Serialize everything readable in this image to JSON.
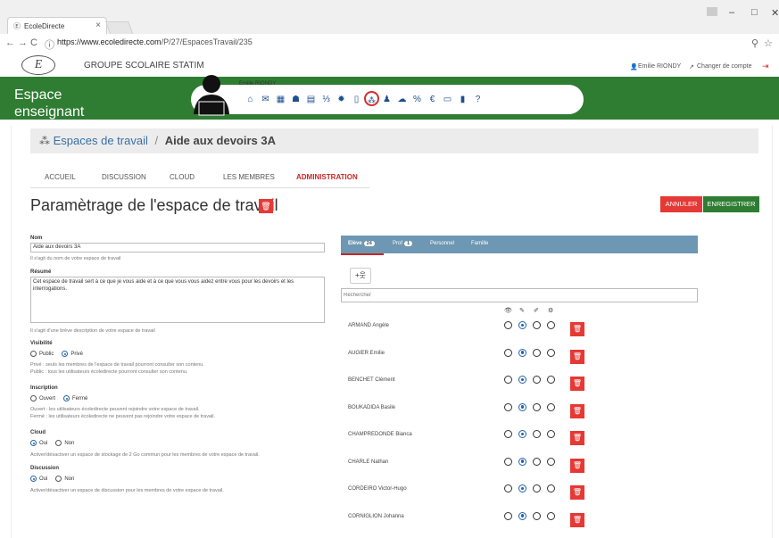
{
  "browser": {
    "tab_title": "EcoleDirecte",
    "tab_close": "×",
    "url_domain": "https://www.ecoledirecte.com",
    "url_path": "/P/27/EspacesTravail/235",
    "minimize": "–",
    "maximize": "□",
    "close": "✕",
    "back": "←",
    "forward": "→",
    "reload": "C",
    "info": "ⓘ",
    "ext_icon": "⚲",
    "star_icon": "☆"
  },
  "school": {
    "logo": "E",
    "name": "GROUPE SCOLAIRE STATIM",
    "user": "Emilie RIONDY",
    "change_account": "Changer de compte",
    "logout": "⇥"
  },
  "header": {
    "space_line1": "Espace",
    "space_line2": "enseignant",
    "profile_name": "Emilie RIONDY",
    "nav_icons": [
      "home-icon",
      "mail-icon",
      "calendar-icon",
      "students-icon",
      "clipboard-icon",
      "grades-icon",
      "settings-icon",
      "notebook-icon",
      "workspaces-icon",
      "meeting-icon",
      "cloud-icon",
      "link-icon",
      "euro-icon",
      "card-icon",
      "book-icon",
      "help-icon"
    ],
    "nav_glyphs": [
      "⌂",
      "✉",
      "▦",
      "☗",
      "▤",
      "⅓",
      "✹",
      "▯",
      "⁂",
      "♟",
      "☁",
      "%",
      "€",
      "▭",
      "▮",
      "?"
    ],
    "active_index": 8
  },
  "breadcrumb": {
    "root": "Espaces de travail",
    "separator": "/",
    "current": "Aide aux devoirs 3A"
  },
  "tabs": [
    "ACCUEIL",
    "DISCUSSION",
    "CLOUD",
    "LES MEMBRES",
    "ADMINISTRATION"
  ],
  "page": {
    "title": "Paramètrage de l'espace de travail",
    "cancel": "ANNULER",
    "save": "ENREGISTRER"
  },
  "form": {
    "name_label": "Nom",
    "name_value": "Aide aux devoirs 3A",
    "name_help": "Il s'agit du nom de votre espace de travail",
    "summary_label": "Résumé",
    "summary_value": "Cet espace de travail sert à ce que je vous aide et à ce que vous vous aidez entre vous pour les devoirs et les interrogations.",
    "summary_help": "Il s'agit d'une brève description de votre espace de travail",
    "visibility_label": "Visibilité",
    "visibility_public": "Public",
    "visibility_private": "Privé",
    "visibility_help1": "Privé : seuls les membres de l'espace de travail pourront consulter son contenu.",
    "visibility_help2": "Public : tous les utilisateurs écoledirecte pourront consulter son contenu.",
    "inscription_label": "Inscription",
    "inscription_open": "Ouvert",
    "inscription_closed": "Fermé",
    "inscription_help1": "Ouvert : les utilisateurs écoledirecte peuvent rejoindre votre espace de travail.",
    "inscription_help2": "Fermé : les utilisateurs écoledirecte ne peuvent pas rejoindre votre espace de travail.",
    "cloud_label": "Cloud",
    "cloud_yes": "Oui",
    "cloud_no": "Non",
    "cloud_help": "Activer/désactiver un espace de stockage de 2 Go commun pour les membres de votre espace de travail.",
    "discussion_label": "Discussion",
    "discussion_yes": "Oui",
    "discussion_no": "Non",
    "discussion_help": "Activer/désactiver un espace de discussion pour les membres de votre espace de travail."
  },
  "members": {
    "tabs": [
      {
        "label": "Elève",
        "count": "24"
      },
      {
        "label": "Prof",
        "count": "1"
      },
      {
        "label": "Personnel",
        "count": ""
      },
      {
        "label": "Famille",
        "count": ""
      }
    ],
    "add_button": "+웃",
    "search_placeholder": "Rechercher",
    "perm_icons": [
      "eye-icon",
      "pencil-icon",
      "eraser-icon",
      "admin-icon"
    ],
    "perm_glyphs": [
      "👁",
      "✎",
      "✐",
      "⚙"
    ],
    "students": [
      {
        "name": "ARMAND Angèle",
        "selected": 1
      },
      {
        "name": "AUGIER Emilie",
        "selected": 1
      },
      {
        "name": "BENCHET Clément",
        "selected": 1
      },
      {
        "name": "BOUKADIDA Basile",
        "selected": 1
      },
      {
        "name": "CHAMPREDONDE Bianca",
        "selected": 1
      },
      {
        "name": "CHARLE Nathan",
        "selected": 1
      },
      {
        "name": "CORDEIRO Victor-Hugo",
        "selected": 1
      },
      {
        "name": "CORNIGLION Johanna",
        "selected": 1
      }
    ],
    "trash_glyph": "🗑"
  },
  "colors": {
    "green": "#2f7d32",
    "red": "#e53935",
    "tabbar": "#6d97b2",
    "link_blue": "#3a6ea5"
  }
}
